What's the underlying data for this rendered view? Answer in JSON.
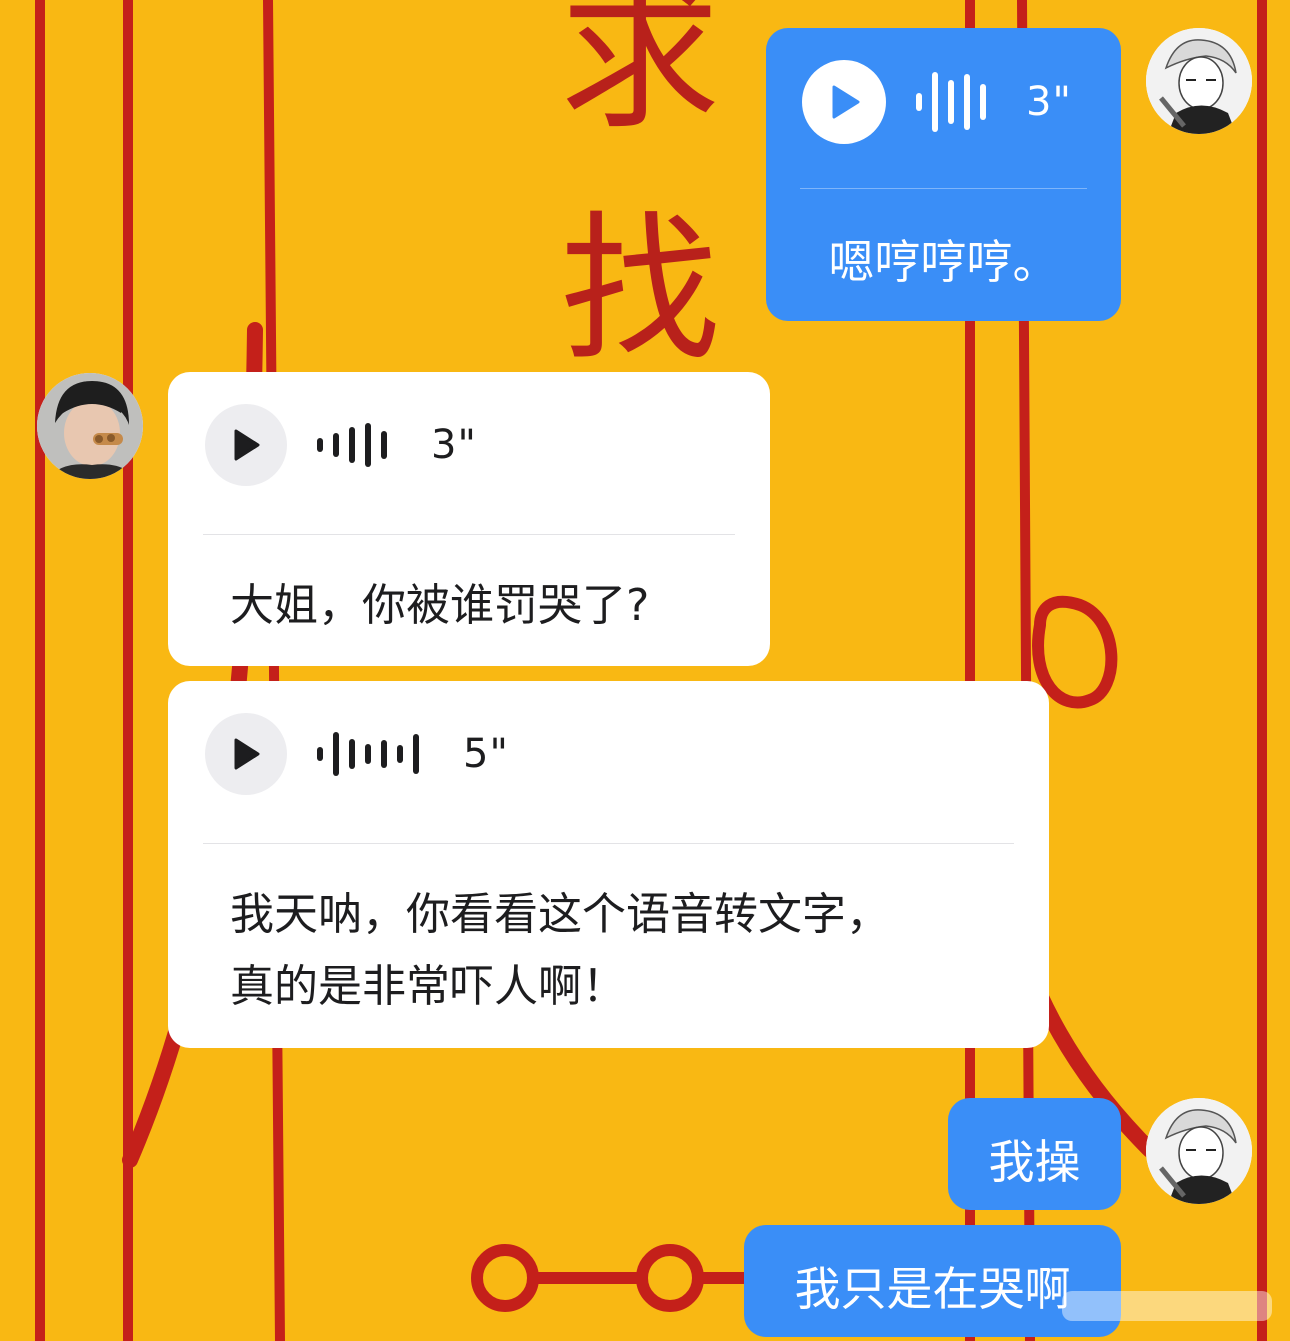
{
  "background": {
    "color": "#f9b813",
    "line_color": "#c4201a",
    "glyphs": [
      "求",
      "找"
    ]
  },
  "colors": {
    "outgoing_bubble": "#3a8ef7",
    "incoming_bubble": "#ffffff"
  },
  "messages": [
    {
      "side": "outgoing",
      "type": "voice",
      "avatar": "anime-avatar",
      "duration": "3\"",
      "transcript": "嗯哼哼哼。"
    },
    {
      "side": "incoming",
      "type": "voice",
      "avatar": "photo-avatar",
      "duration": "3\"",
      "transcript": "大姐，你被谁罚哭了?"
    },
    {
      "side": "incoming",
      "type": "voice",
      "duration": "5\"",
      "transcript": "我天呐，你看看这个语音转文字，\n真的是非常吓人啊！"
    },
    {
      "side": "outgoing",
      "type": "text",
      "avatar": "anime-avatar",
      "text": "我操"
    },
    {
      "side": "outgoing",
      "type": "text",
      "text": "我只是在哭啊"
    }
  ]
}
